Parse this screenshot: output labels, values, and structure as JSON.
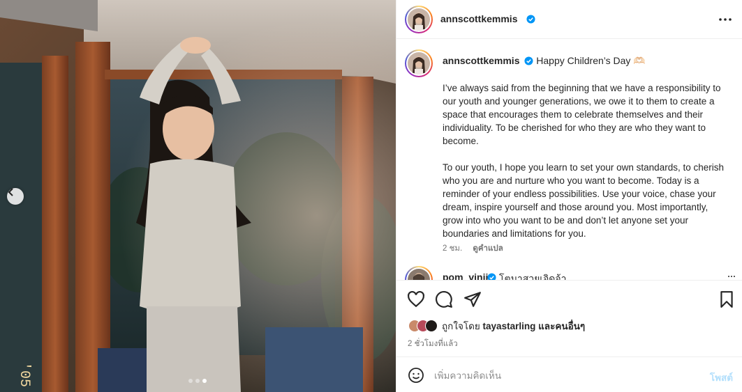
{
  "post": {
    "author": "annscottkemmis",
    "caption_title": "Happy Children’s Day 🫶🏻",
    "caption_paragraph_1": "I’ve always said from the beginning that we have a responsibility to our youth and younger generations, we owe it to them to create a space that encourages them to celebrate themselves and their individuality. To be cherished for who they are who they want to become.",
    "caption_paragraph_2": "To our youth, I hope you learn to set your own standards, to cherish who you are and nurture who you want to become. Today is a reminder of your endless possibilities. Use your voice, chase your dream, inspire yourself and those around you. Most importantly, grow into who you want to be and don’t let anyone set your boundaries and limitations for you.",
    "caption_time": "2 ชม.",
    "translate_label": "ดูคำแปล"
  },
  "next_comment": {
    "user": "pom_vinij",
    "text": "โตมาสวยเจิดจ้า"
  },
  "likes": {
    "prefix": "ถูกใจโดย",
    "user": "tayastarling",
    "suffix": "และคนอื่นๆ"
  },
  "time_ago": "2 ชั่วโมงที่แล้ว",
  "comment_box": {
    "placeholder": "เพิ่มความคิดเห็น",
    "post_label": "โพสต์"
  },
  "carousel": {
    "total": 3,
    "active_index": 2
  },
  "icons": [
    "verified-badge-icon",
    "more-options-icon",
    "heart-icon",
    "comment-icon",
    "share-icon",
    "bookmark-icon",
    "emoji-icon",
    "chevron-left-icon"
  ],
  "colors": {
    "verified": "#0095f6",
    "post_button": "#b2dffc",
    "secondary_text": "#737373"
  }
}
